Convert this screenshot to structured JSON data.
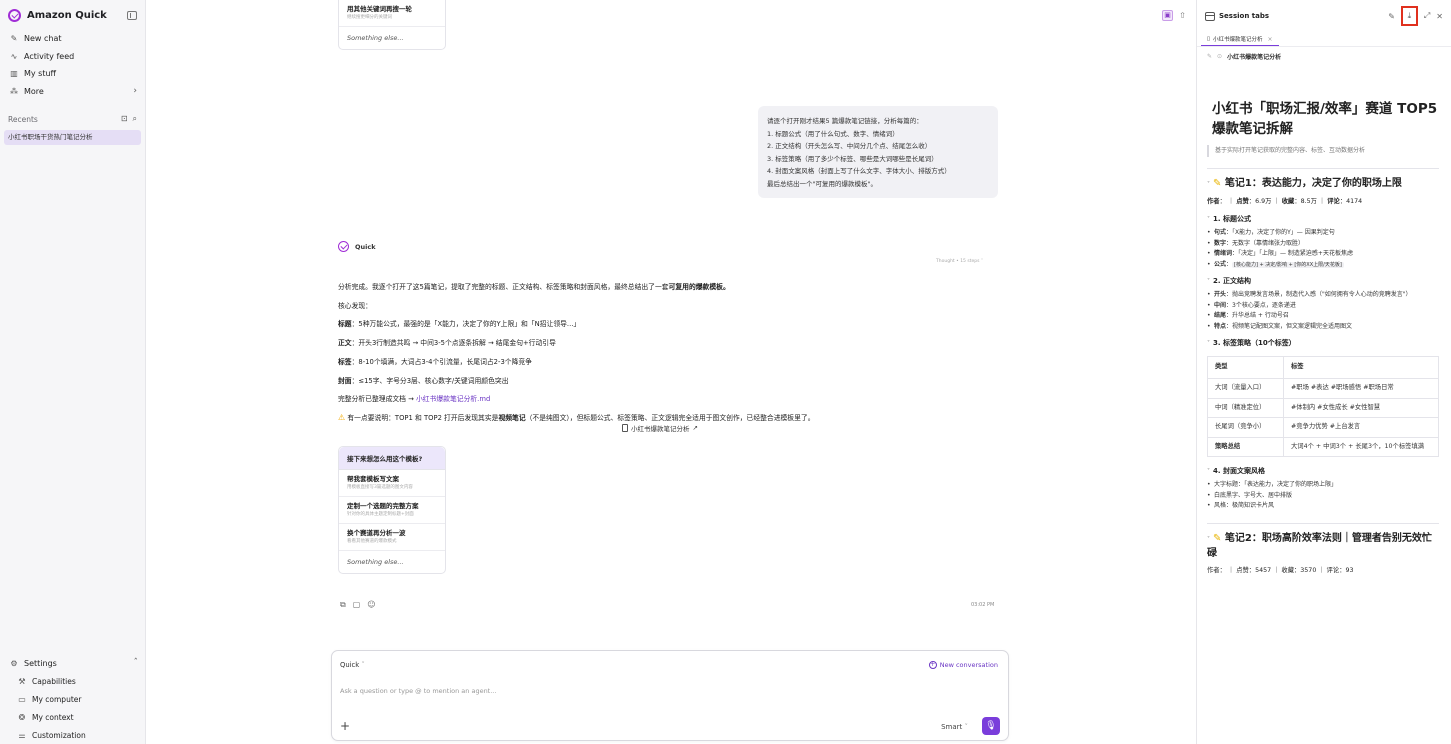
{
  "sidebar": {
    "app_title": "Amazon Quick",
    "nav": [
      {
        "label": "New chat",
        "icon": "edit-icon"
      },
      {
        "label": "Activity feed",
        "icon": "activity-icon"
      },
      {
        "label": "My stuff",
        "icon": "library-icon"
      },
      {
        "label": "More",
        "icon": "apps-icon"
      }
    ],
    "recents_label": "Recents",
    "recent_item": "小红书职场干货热门笔记分析",
    "bottom": {
      "settings": "Settings",
      "items": [
        "Capabilities",
        "My computer",
        "My context",
        "Customization"
      ]
    }
  },
  "main": {
    "top_suggestions": {
      "items": [
        {
          "title": "用其他关键词再搜一轮",
          "sub": "继续搜更细分的关键词"
        }
      ],
      "something_else": "Something else..."
    },
    "user_message": {
      "lines": [
        "请逐个打开刚才结果5 篇爆款笔记链接，分析每篇的：",
        "1. 标题公式（用了什么句式、数字、情绪词）",
        "2. 正文结构（开头怎么写、中间分几个点、结尾怎么收）",
        "3. 标签策略（用了多少个标签、哪些是大词哪些是长尾词）",
        "4. 封面文案风格（封面上写了什么文字、字体大小、排版方式）",
        "最后总结出一个\"可复用的爆款模板\"。"
      ]
    },
    "assistant": {
      "name": "Quick",
      "thought": "Thought • 15 steps",
      "intro_prefix": "分析完成。我逐个打开了这5篇笔记，提取了完整的标题、正文结构、标签策略和封面风格，最终总结出了一套",
      "intro_bold": "可复用的爆款模板。",
      "core_label": "核心发现：",
      "findings": [
        {
          "label": "标题",
          "text": "：5种万能公式，最强的是「X能力，决定了你的Y上限」和「N招让领导...」"
        },
        {
          "label": "正文",
          "text": "：开头3行制造共鸣 → 中间3-5个点逐条拆解 → 结尾金句+行动引导"
        },
        {
          "label": "标签",
          "text": "：8-10个填满，大词占3-4个引流量，长尾词占2-3个降竞争"
        },
        {
          "label": "封面",
          "text": "：≤15字、字号分3层、核心数字/关键词用颜色突出"
        }
      ],
      "saved_prefix": "完整分析已整理成文档 → ",
      "saved_link": "小红书爆款笔记分析.md",
      "warning_icon": "⚠",
      "warning_prefix": "有一点要说明：TOP1 和 TOP2 打开后发现其实是",
      "warning_bold": "视频笔记",
      "warning_suffix": "（不是纯图文），但标题公式、标签策略、正文逻辑完全适用于图文创作，已经整合进模板里了。",
      "file_chip": "小红书爆款笔记分析",
      "time": "03:02 PM"
    },
    "followups": {
      "header": "接下来想怎么用这个模板?",
      "items": [
        {
          "title": "帮我套模板写文案",
          "sub": "用模板直接写3篇选题的图文内容"
        },
        {
          "title": "定制一个选题的完整方案",
          "sub": "针对你的具体主题定制标题+封面"
        },
        {
          "title": "换个赛道再分析一波",
          "sub": "看看其他赛道的爆款模式"
        }
      ],
      "something_else": "Something else..."
    },
    "composer": {
      "mode": "Quick",
      "new_conversation": "New conversation",
      "placeholder": "Ask a question or type @ to mention an agent...",
      "add": "+",
      "model": "Smart"
    }
  },
  "panel": {
    "title": "Session tabs",
    "tab_label": "小红书爆款笔记分析",
    "doc_name": "小红书爆款笔记分析",
    "doc_title": "小红书「职场汇报/效率」赛道 TOP5 爆款笔记拆解",
    "doc_quote": "基于实际打开笔记获取的完整内容、标签、互动数据分析",
    "note1": {
      "heading": "笔记1：表达能力，决定了你的职场上限",
      "meta_author_label": "作者",
      "meta_author": "：",
      "meta_likes_label": "点赞",
      "meta_likes": "：6.9万",
      "meta_saves_label": "收藏",
      "meta_saves": "：8.5万",
      "meta_comments_label": "评论",
      "meta_comments": "：4174",
      "sec1": "1. 标题公式",
      "sec1_items": [
        {
          "label": "句式",
          "text": "：「X能力，决定了你的Y」— 因果判定句"
        },
        {
          "label": "数字",
          "text": "：无数字（靠情绪张力取胜）"
        },
        {
          "label": "情绪词",
          "text": "：「决定」「上限」— 制造紧迫感+天花板焦虑"
        },
        {
          "label": "公式",
          "text": "：",
          "code": "[核心能力] + 决定/影响 + [你的XX上限/天花板]"
        }
      ],
      "sec2": "2. 正文结构",
      "sec2_items": [
        {
          "label": "开头",
          "text": "：抛出竞聘发言场景，制造代入感（\"如何拥有令人心动的竞聘发言\"）"
        },
        {
          "label": "中间",
          "text": "：3个核心要点，逐条递进"
        },
        {
          "label": "结尾",
          "text": "：升华总结 + 行动号召"
        },
        {
          "label": "特点",
          "text": "：视频笔记配图文案，但文案逻辑完全适用图文"
        }
      ],
      "sec3": "3. 标签策略（10个标签）",
      "table_headers": [
        "类型",
        "标签"
      ],
      "table_rows": [
        [
          "大词（流量入口）",
          "#职场 #表达 #职场感悟 #职场日常"
        ],
        [
          "中词（精准定位）",
          "#体制内 #女性成长 #女性智慧"
        ],
        [
          "长尾词（竞争小）",
          "#竞争力优势 #上台发言"
        ],
        [
          "策略总结",
          "大词4个 + 中词3个 + 长尾3个，10个标签填满"
        ]
      ],
      "sec4": "4. 封面文案风格",
      "sec4_items": [
        "大字标题：「表达能力，决定了你的职场上限」",
        "白底黑字、字号大、居中排版",
        "风格：极简知识卡片风"
      ]
    },
    "note2_heading": "笔记2：职场高阶效率法则｜管理者告别无效忙碌",
    "note2_meta": "作者：  ｜ 点赞：5457 ｜ 收藏：3570 ｜ 评论：93"
  }
}
